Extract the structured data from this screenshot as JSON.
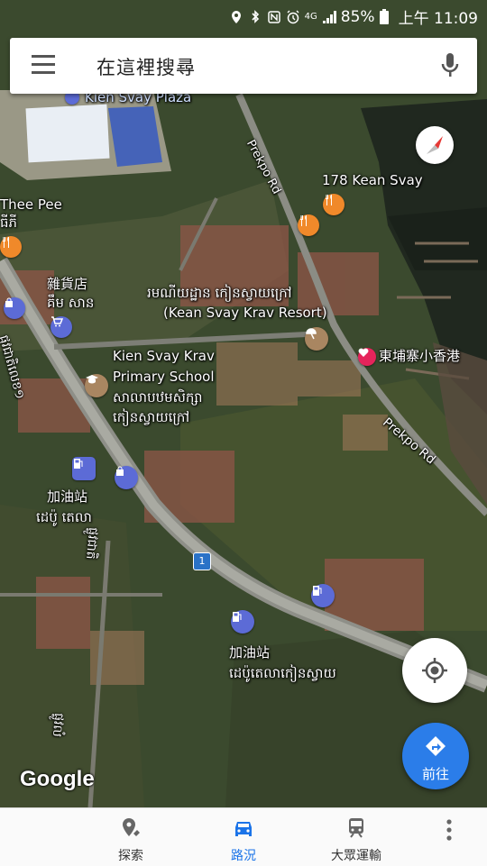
{
  "status": {
    "battery": "85%",
    "time": "上午 11:09",
    "network": "4G"
  },
  "search": {
    "placeholder": "在這裡搜尋"
  },
  "map": {
    "labels": {
      "kien_svay_plaza": "Kien Svay Plaza",
      "kean_svay_178": "178 Kean Svay",
      "thee_pee": "Thee Pee",
      "thee_pee_km": "ធីភី",
      "grocery_zh": "雜貨店",
      "grocery_km": "គឹម សាន",
      "resort_km": "រមណីយដ្ឋាន កៀនស្វាយក្រៅ",
      "resort_en": "(Kean Svay Krav Resort)",
      "school_en_1": "Kien Svay Krav",
      "school_en_2": "Primary School",
      "school_km_1": "សាលាបឋមសិក្សា",
      "school_km_2": "កៀនស្វាយក្រៅ",
      "hk_restaurant": "東埔寨小香港",
      "prekpo_rd_1": "Prekpo Rd",
      "prekpo_rd_2": "Prekpo Rd",
      "gas1_zh": "加油站",
      "gas1_km": "ដេប៉ូ តេលា",
      "gas2_zh": "加油站",
      "gas2_km": "ដេប៉ូតេលាកៀនស្វាយ",
      "road_km": "ផ្លូវជាតិលេខ១",
      "road_km_2": "ផ្លូវជាតិ",
      "road_km_3": "ផ្លូវលំ",
      "road_shield": "1",
      "google": "Google"
    }
  },
  "buttons": {
    "go_label": "前往"
  },
  "bottom_nav": {
    "items": [
      {
        "label": "探索",
        "icon": "pin-icon"
      },
      {
        "label": "路況",
        "icon": "car-icon"
      },
      {
        "label": "大眾運輸",
        "icon": "train-icon"
      }
    ]
  },
  "colors": {
    "accent": "#1a73e8",
    "go_button": "#2b7de9",
    "food_pin": "#f0892a",
    "gas_pin": "#5c6bd6",
    "heart_pin": "#e5245b"
  }
}
